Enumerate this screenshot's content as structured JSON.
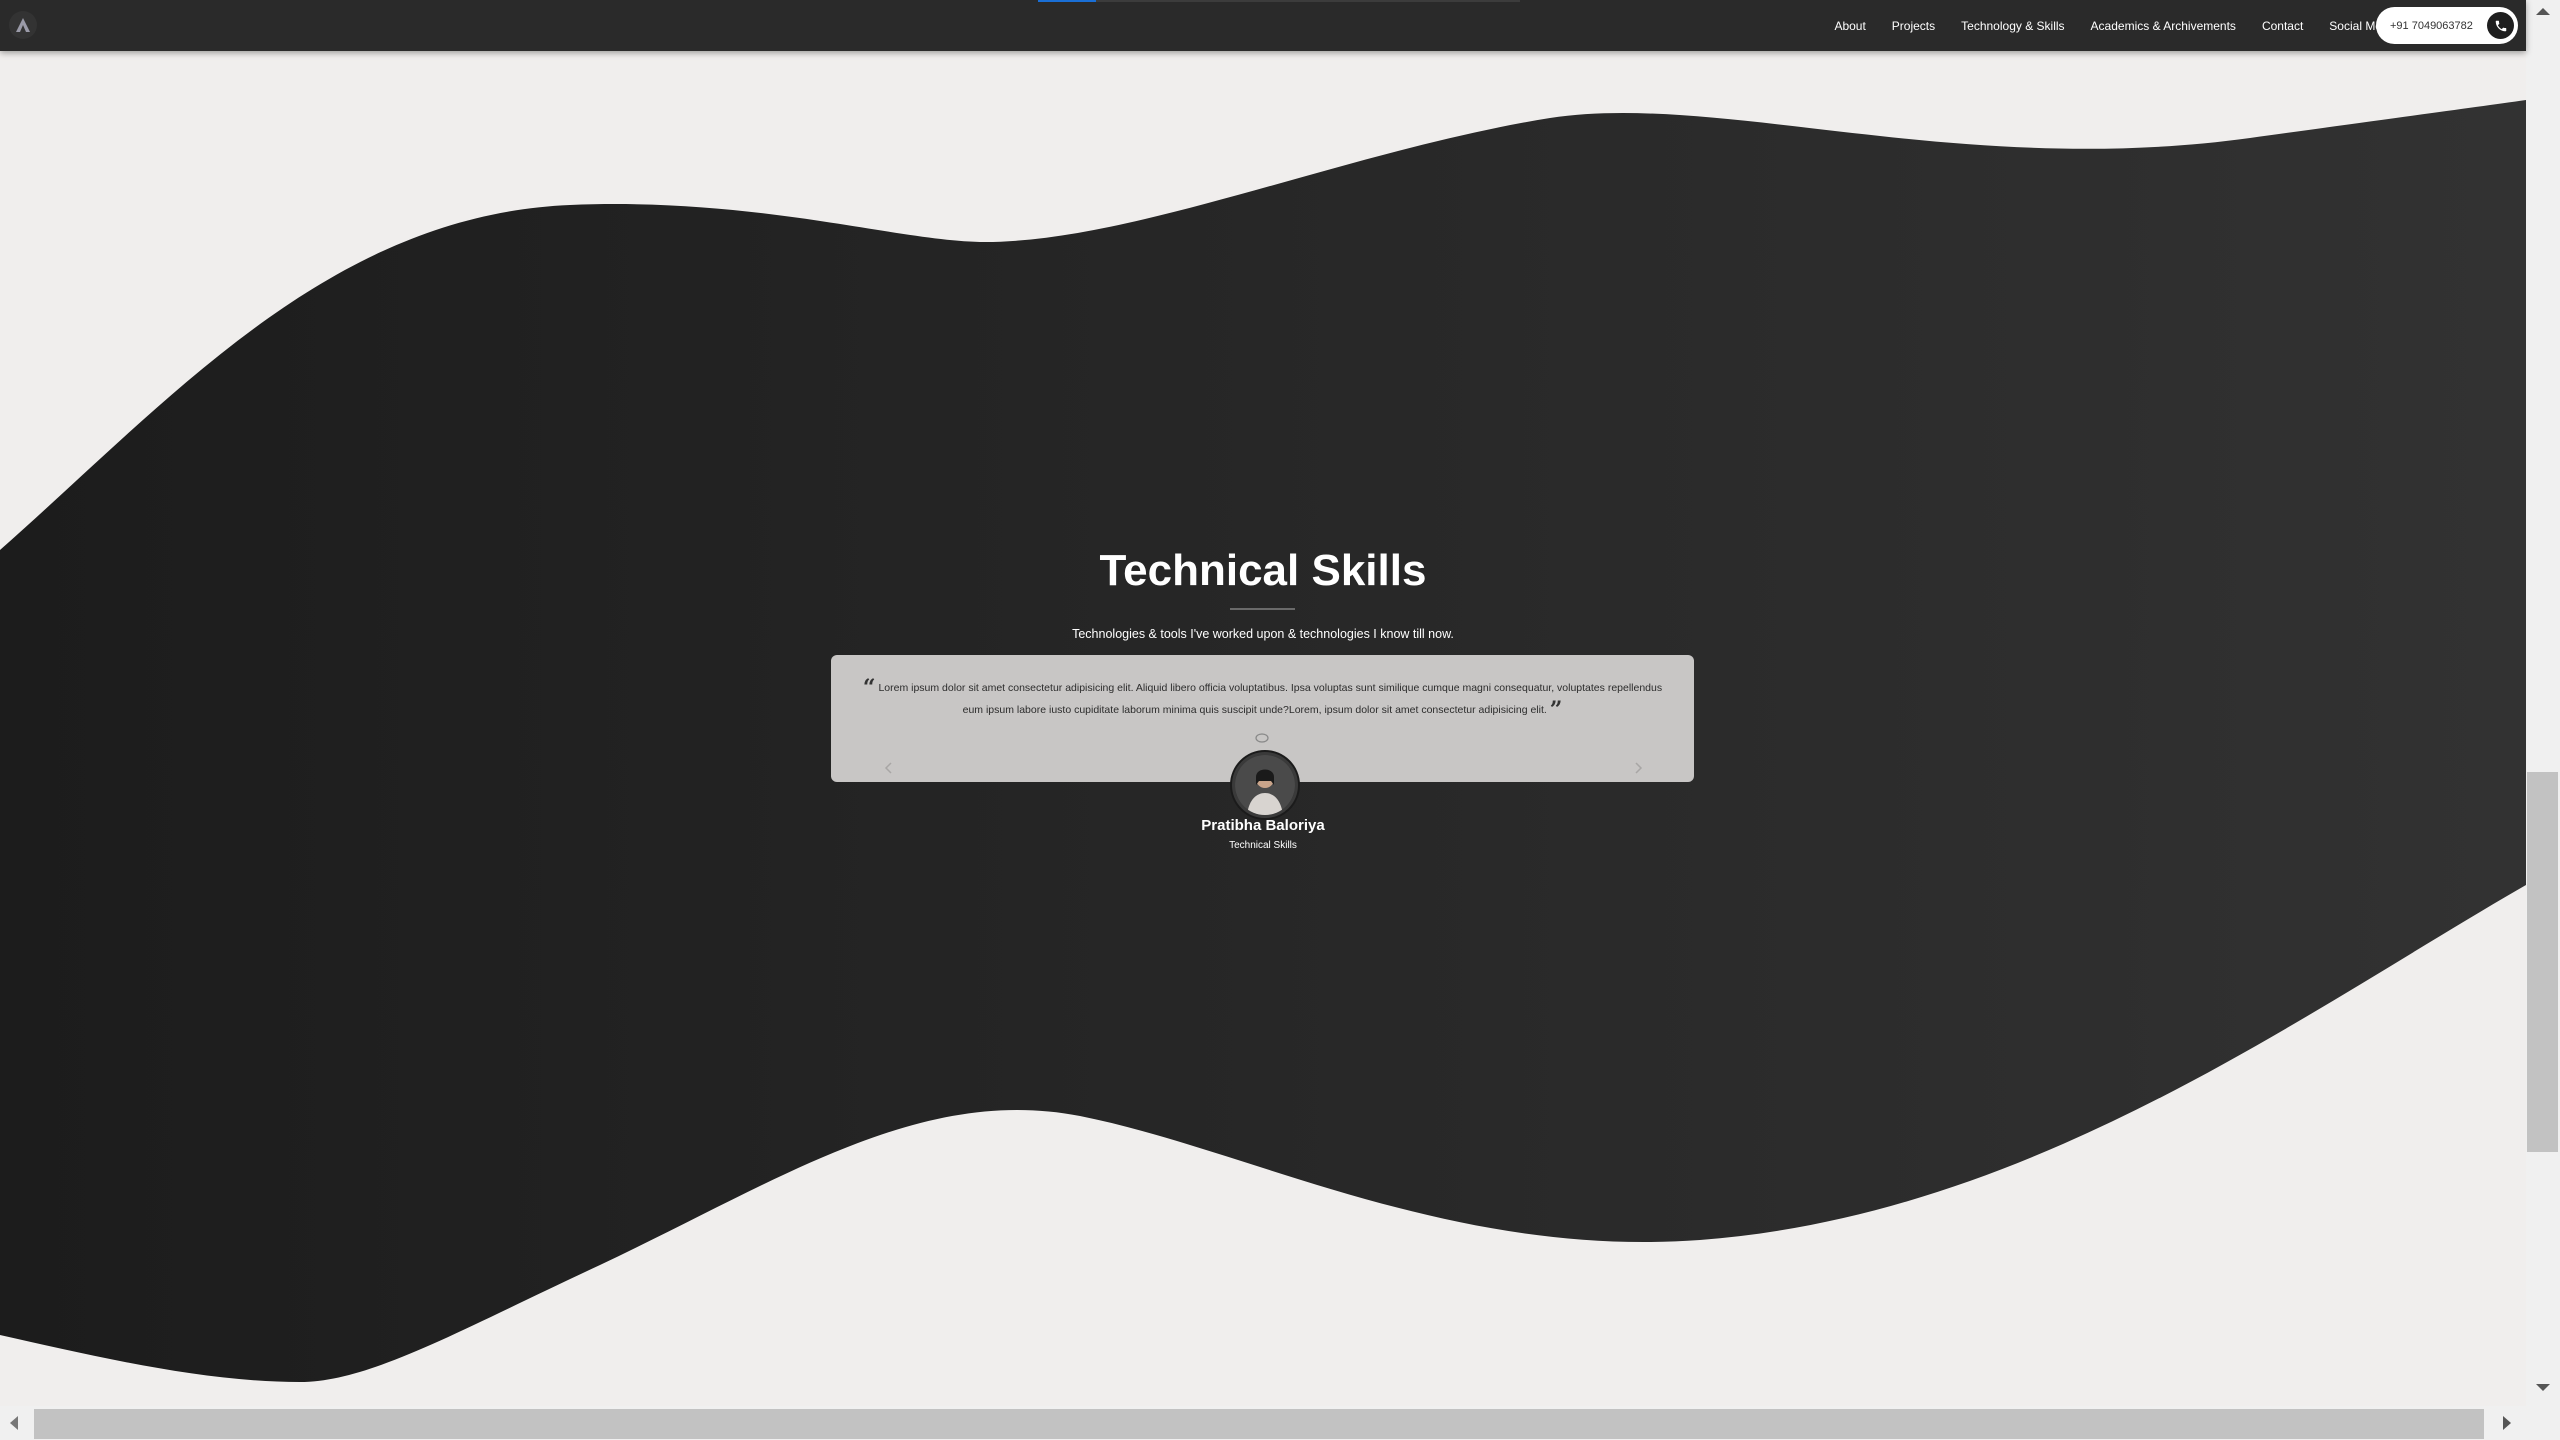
{
  "nav": {
    "logo": "logo-mark",
    "scroll_progress": 0.12,
    "links": [
      {
        "label": "About"
      },
      {
        "label": "Projects"
      },
      {
        "label": "Technology & Skills"
      },
      {
        "label": "Academics & Archivements"
      },
      {
        "label": "Contact"
      },
      {
        "label": "Social Media"
      }
    ],
    "phone": "+91 7049063782",
    "phone_icon": "phone-icon"
  },
  "section": {
    "title": "Technical Skills",
    "subtitle": "Technologies & tools I've worked upon & technologies I know till now."
  },
  "testimonial": {
    "quote": "Lorem ipsum dolor sit amet consectetur adipisicing elit. Aliquid libero officia voluptatibus. Ipsa voluptas sunt similique cumque magni consequatur, voluptates repellendus eum ipsum labore iusto cupiditate laborum minima quis suscipit unde?Lorem, ipsum dolor sit amet consectetur adipisicing elit.",
    "name": "Pratibha Baloriya",
    "role": "Technical Skills"
  },
  "colors": {
    "wave": "#1f1f1f",
    "background": "#f0eeed",
    "card": "#c8c6c5",
    "navbar": "#2a2a2a",
    "accent": "#1a6fd6"
  }
}
